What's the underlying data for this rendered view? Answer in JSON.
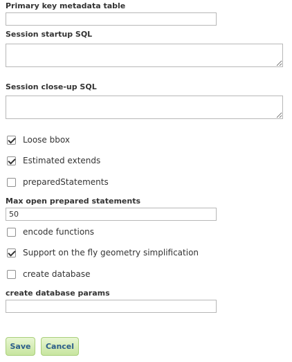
{
  "form": {
    "primary_key": {
      "label": "Primary key metadata table",
      "value": ""
    },
    "session_startup": {
      "label": "Session startup SQL",
      "value": ""
    },
    "session_closeup": {
      "label": "Session close-up SQL",
      "value": ""
    },
    "checkboxes": [
      {
        "label": "Loose bbox",
        "checked": true
      },
      {
        "label": "Estimated extends",
        "checked": true
      },
      {
        "label": "preparedStatements",
        "checked": false
      },
      {
        "label": "encode functions",
        "checked": false
      },
      {
        "label": "Support on the fly geometry simplification",
        "checked": true
      },
      {
        "label": "create database",
        "checked": false
      }
    ],
    "max_open_prepared": {
      "label": "Max open prepared statements",
      "value": "50"
    },
    "create_db_params": {
      "label": "create database params",
      "value": ""
    }
  },
  "buttons": {
    "save": "Save",
    "cancel": "Cancel"
  },
  "colors": {
    "button_bg": "#c7e59f",
    "button_text": "#2b5d8a",
    "label_text": "#333333"
  }
}
